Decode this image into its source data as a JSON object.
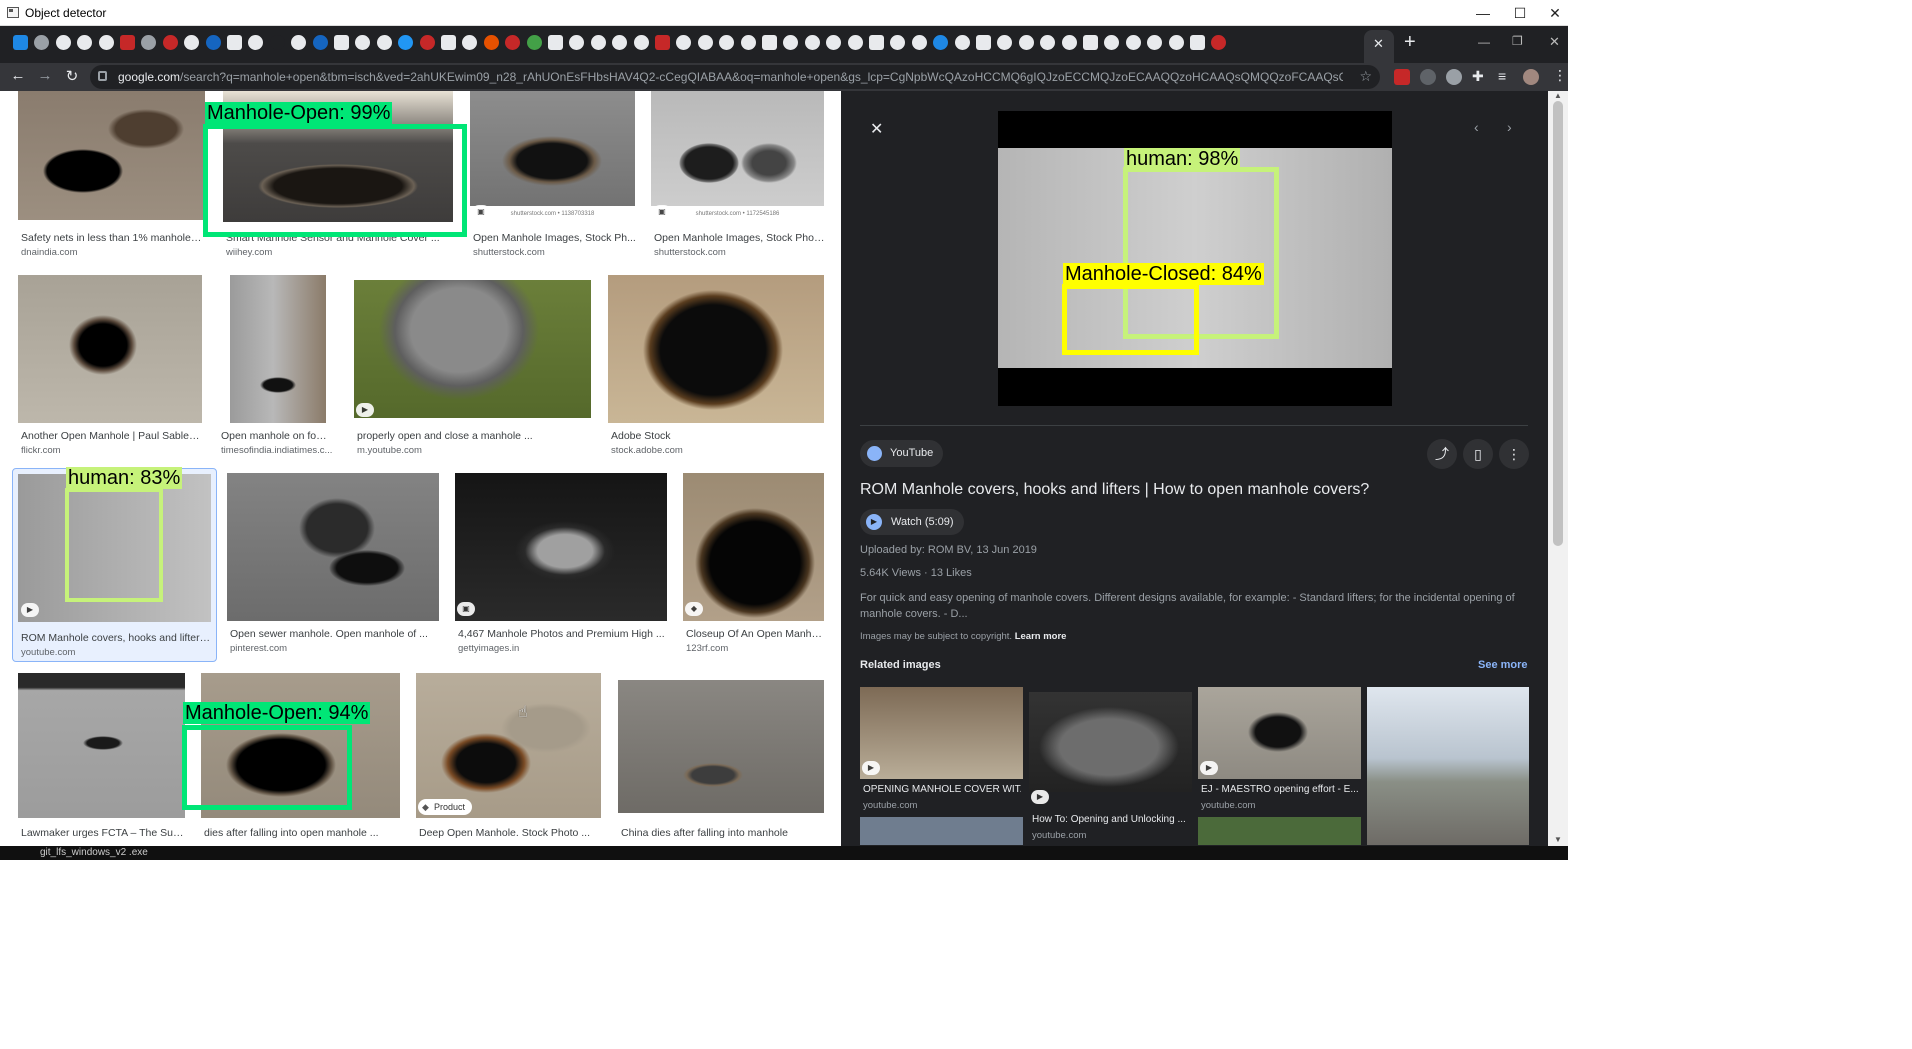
{
  "window": {
    "title": "Object detector",
    "minimize": "—",
    "maximize": "☐",
    "close": "✕"
  },
  "browser": {
    "url_domain": "google.com",
    "url_rest": "/search?q=manhole+open&tbm=isch&ved=2ahUKEwim09_n28_rAhUOnEsFHbsHAV4Q2-cCegQIABAA&oq=manhole+open&gs_lcp=CgNpbWcQAzoHCCMQ6gIQJzoECCMQJzoECAAQQzoHCAAQsQMQQzoFCAAQsQM6AggAUKs...",
    "new_tab": "+",
    "tab_close": "✕"
  },
  "grid": {
    "tiles": [
      {
        "caption": "Safety nets in less than 1% manholes i...",
        "source": "dnaindia.com"
      },
      {
        "caption": "Smart Manhole Sensor and Manhole Cover ...",
        "source": "wiihey.com"
      },
      {
        "caption": "Open Manhole Images, Stock Ph...",
        "source": "shutterstock.com"
      },
      {
        "caption": "Open Manhole Images, Stock Phot...",
        "source": "shutterstock.com"
      },
      {
        "caption": "Another Open Manhole | Paul Sablem...",
        "source": "flickr.com"
      },
      {
        "caption": "Open manhole on foot...",
        "source": "timesofindia.indiatimes.c..."
      },
      {
        "caption": "properly open and close a manhole ...",
        "source": "m.youtube.com"
      },
      {
        "caption": "Adobe Stock",
        "source": "stock.adobe.com"
      },
      {
        "caption": "ROM Manhole covers, hooks and lifters ...",
        "source": "youtube.com"
      },
      {
        "caption": "Open sewer manhole. Open manhole of ...",
        "source": "pinterest.com"
      },
      {
        "caption": "4,467 Manhole Photos and Premium High ...",
        "source": "gettyimages.in"
      },
      {
        "caption": "Closeup Of An Open Manhol...",
        "source": "123rf.com"
      },
      {
        "caption": "Lawmaker urges FCTA – The Sun ...",
        "source": ""
      },
      {
        "caption": "dies after falling into open manhole ...",
        "source": ""
      },
      {
        "caption": "Deep Open Manhole. Stock Photo ...",
        "source": ""
      },
      {
        "caption": "China dies after falling into manhole",
        "source": ""
      }
    ],
    "watermark_1": "shutterstock.com • 1138703318",
    "watermark_2": "shutterstock.com • 1172545186",
    "product_badge": "Product"
  },
  "detections": {
    "d1": "Manhole-Open: 99%",
    "d2": "human: 83%",
    "d3": "Manhole-Open: 94%",
    "d4": "human: 98%",
    "d5": "Manhole-Closed: 84%"
  },
  "panel": {
    "source_name": "YouTube",
    "title": "ROM Manhole covers, hooks and lifters | How to open manhole covers?",
    "watch": "Watch (5:09)",
    "uploaded": "Uploaded by: ROM BV, 13 Jun 2019",
    "stats": "5.64K Views · 13 Likes",
    "description": "For quick and easy opening of manhole covers. Different designs available, for example: - Standard lifters; for the incidental opening of manhole covers. - D...",
    "copyright": "Images may be subject to copyright.",
    "learn_more": "Learn more",
    "related_title": "Related images",
    "see_more": "See more",
    "related": [
      {
        "caption": "OPENING MANHOLE COVER WIT...",
        "source": "youtube.com"
      },
      {
        "caption": "How To: Opening and Unlocking ...",
        "source": "youtube.com"
      },
      {
        "caption": "EJ - MAESTRO opening effort - E...",
        "source": "youtube.com"
      },
      {
        "caption": "",
        "source": ""
      }
    ]
  },
  "taskbar": {
    "text": "git_lfs_windows_v2 .exe"
  },
  "colors": {
    "detect_green": "#00e676",
    "detect_lime": "#c6f27a",
    "detect_yellow": "#ffff00",
    "panel_bg": "#202124",
    "link_blue": "#8ab4f8"
  }
}
